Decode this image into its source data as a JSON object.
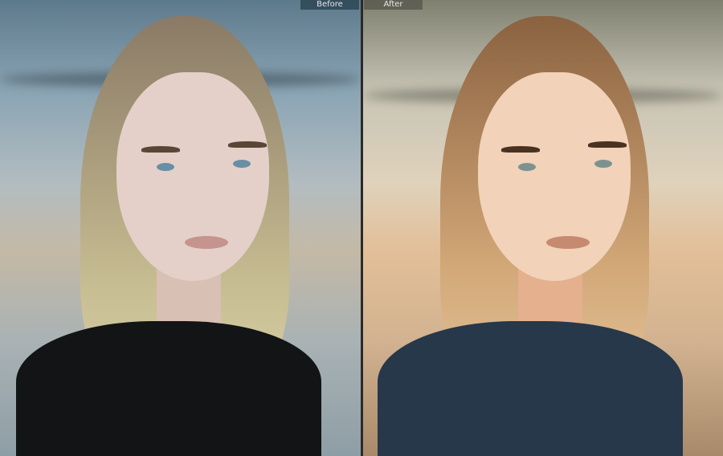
{
  "view": {
    "before_label": "Before",
    "after_label": "After"
  },
  "colors": {
    "before_tone": "#8aa4b4",
    "after_tone": "#e2bf98",
    "divider": "#2a2a2a"
  }
}
